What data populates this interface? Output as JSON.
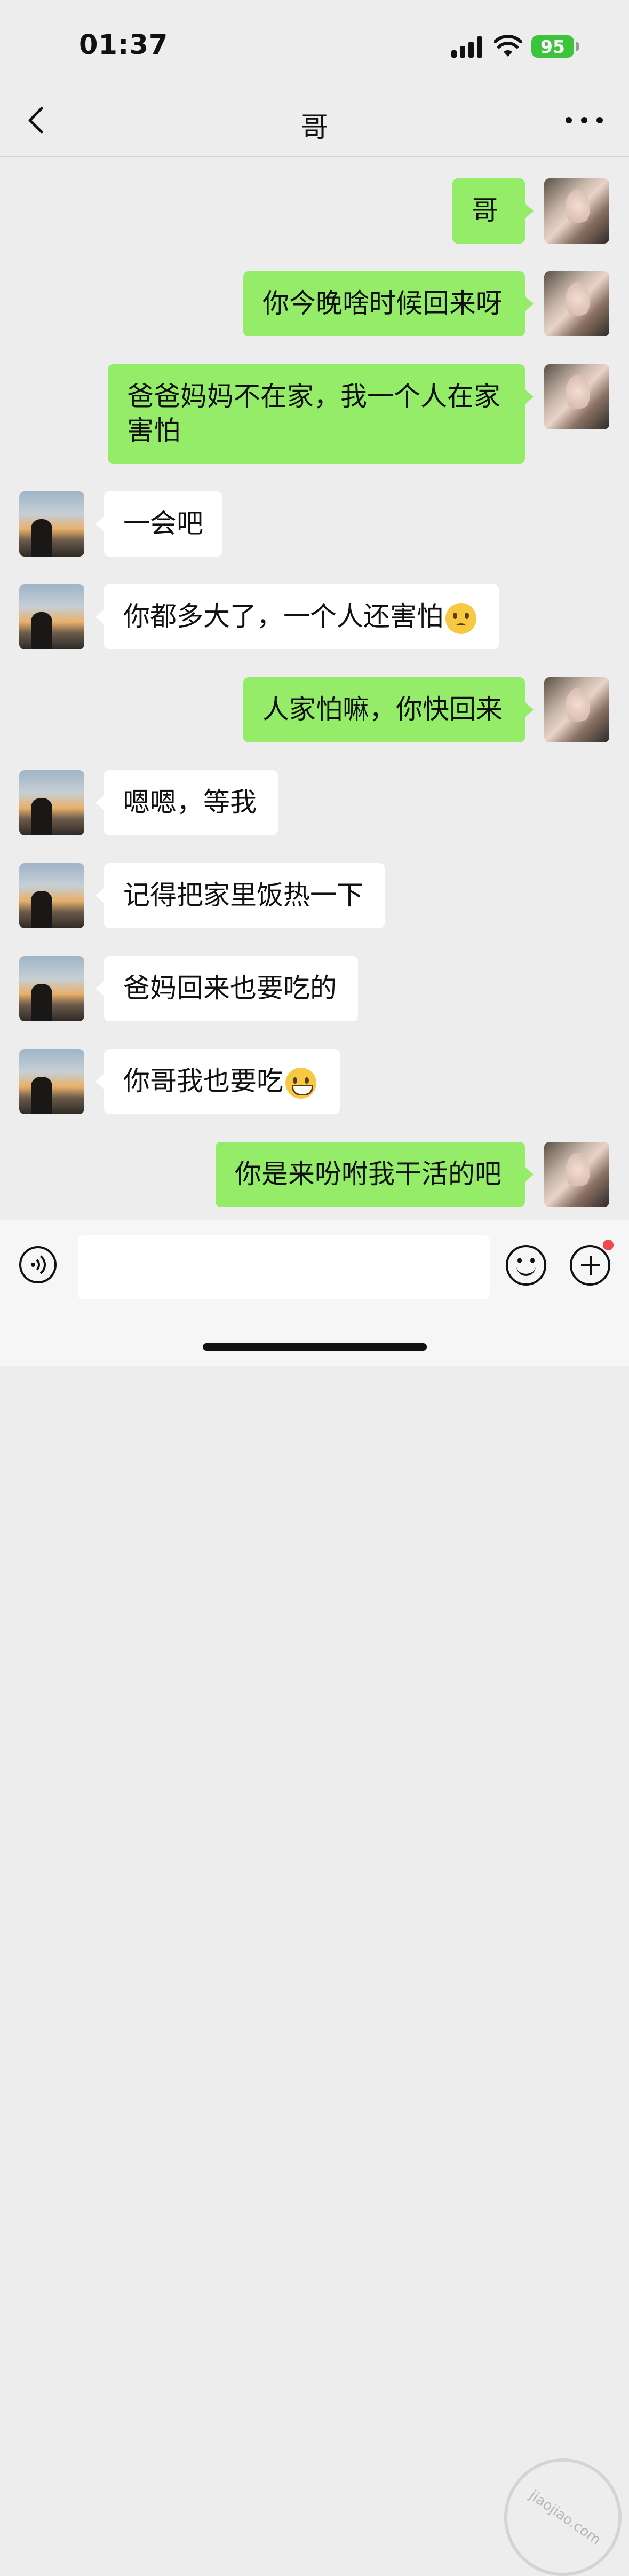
{
  "status_bar": {
    "time": "01:37",
    "battery": "95"
  },
  "nav": {
    "title": "哥"
  },
  "messages": [
    {
      "from": "me",
      "text": "哥"
    },
    {
      "from": "me",
      "text": "你今晚啥时候回来呀"
    },
    {
      "from": "me",
      "text": "爸爸妈妈不在家，我一个人在家\n害怕"
    },
    {
      "from": "bro",
      "text": "一会吧"
    },
    {
      "from": "bro",
      "text": "你都多大了，一个人还害怕",
      "emoji": "pleading-face-emoji"
    },
    {
      "from": "me",
      "text": "人家怕嘛，你快回来"
    },
    {
      "from": "bro",
      "text": "嗯嗯，等我"
    },
    {
      "from": "bro",
      "text": "记得把家里饭热一下"
    },
    {
      "from": "bro",
      "text": "爸妈回来也要吃的"
    },
    {
      "from": "bro",
      "text": "你哥我也要吃",
      "emoji": "grinning-face-emoji"
    },
    {
      "from": "me",
      "text": "你是来吩咐我干活的吧"
    }
  ],
  "input": {
    "value": ""
  },
  "watermark": {
    "text": "jiaojiao.com"
  },
  "colors": {
    "my_bubble": "#95ec69",
    "their_bubble": "#ffffff",
    "background": "#ededed",
    "battery": "#3cc43c"
  }
}
